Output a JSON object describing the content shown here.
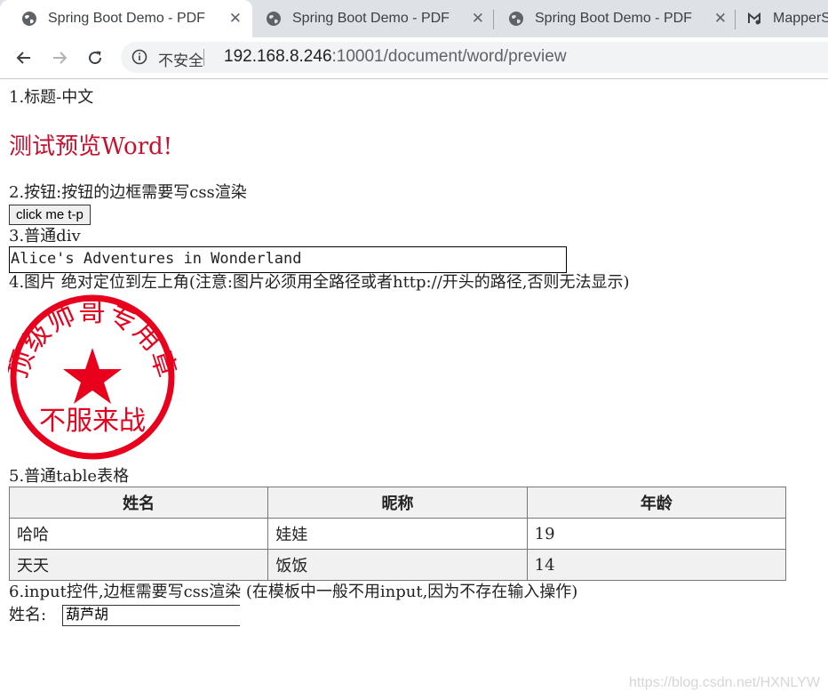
{
  "tabs": [
    {
      "label": "Spring Boot Demo - PDF",
      "active": true,
      "favicon": "globe-icon",
      "close": "✕"
    },
    {
      "label": "Spring Boot Demo - PDF",
      "active": false,
      "favicon": "globe-icon",
      "close": "✕"
    },
    {
      "label": "Spring Boot Demo - PDF",
      "active": false,
      "favicon": "globe-icon",
      "close": "✕"
    },
    {
      "label": "MapperS",
      "active": false,
      "favicon": "mapper-logo-icon"
    }
  ],
  "toolbar": {
    "security_label": "不安全",
    "url_host": "192.168.8.246",
    "url_path": ":10001/document/word/preview"
  },
  "content": {
    "heading1": "1.标题-中文",
    "title": "测试预览Word!",
    "heading2": "2.按钮:按钮的边框需要写css渲染",
    "button_label": "click me t-p",
    "heading3": "3.普通div",
    "div_text": "Alice's Adventures in Wonderland",
    "heading4": "4.图片 绝对定位到左上角(注意:图片必须用全路径或者http://开头的路径,否则无法显示)",
    "stamp": {
      "top_text": "顶级帅哥专用章",
      "bottom_text": "不服来战",
      "color": "#e8001c"
    },
    "heading5": "5.普通table表格",
    "table": {
      "headers": [
        "姓名",
        "昵称",
        "年龄"
      ],
      "rows": [
        [
          "哈哈",
          "娃娃",
          "19"
        ],
        [
          "天天",
          "饭饭",
          "14"
        ]
      ]
    },
    "heading6": "6.input控件,边框需要写css渲染 (在模板中一般不用input,因为不存在输入操作)",
    "input_label": "姓名:",
    "input_value": "葫芦胡"
  },
  "watermark": "https://blog.csdn.net/HXNLYW"
}
